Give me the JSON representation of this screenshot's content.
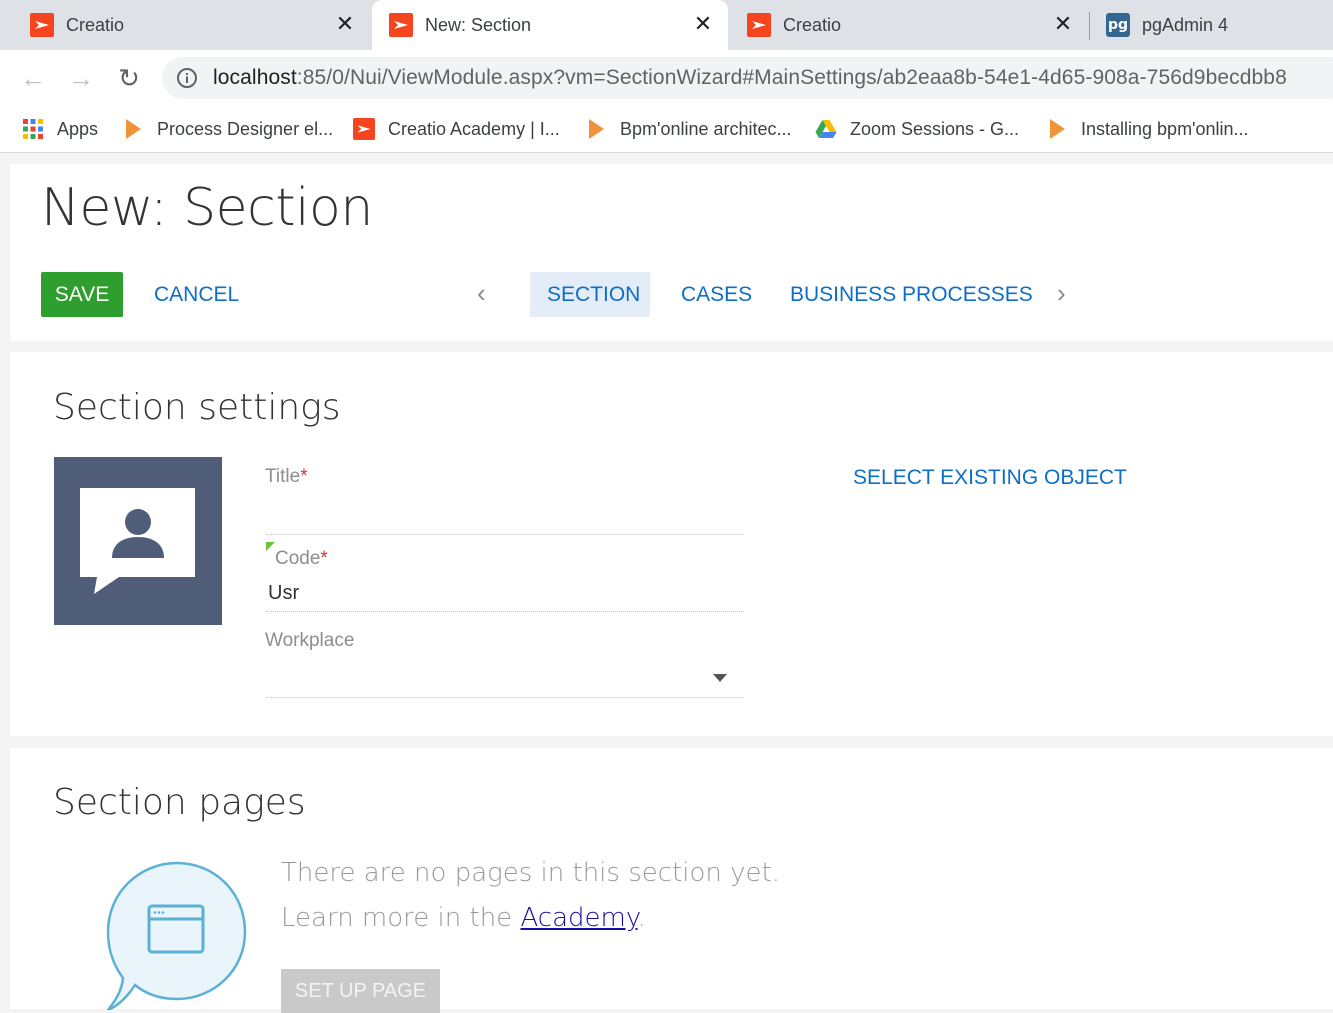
{
  "browser": {
    "tabs": [
      {
        "title": "Creatio",
        "active": false,
        "icon": "creatio-icon"
      },
      {
        "title": "New: Section",
        "active": true,
        "icon": "creatio-icon"
      },
      {
        "title": "Creatio",
        "active": false,
        "icon": "creatio-icon"
      },
      {
        "title": "pgAdmin 4",
        "active": false,
        "icon": "pgadmin-icon"
      }
    ],
    "close_glyph": "✕",
    "pg_icon_text": "pg",
    "url_host": "localhost",
    "url_rest": ":85/0/Nui/ViewModule.aspx?vm=SectionWizard#MainSettings/ab2eaa8b-54e1-4d65-908a-756d9becdbb8",
    "nav": {
      "back": "←",
      "forward": "→",
      "reload": "↻"
    },
    "bookmarks": [
      {
        "label": "Apps",
        "icon": "apps-grid-icon"
      },
      {
        "label": "Process Designer el...",
        "icon": "play-icon"
      },
      {
        "label": "Creatio Academy | I...",
        "icon": "creatio-icon"
      },
      {
        "label": "Bpm'online architec...",
        "icon": "play-icon"
      },
      {
        "label": "Zoom Sessions - G...",
        "icon": "google-drive-icon"
      },
      {
        "label": "Installing bpm'onlin...",
        "icon": "play-icon"
      }
    ]
  },
  "header": {
    "title": "New: Section",
    "save_label": "SAVE",
    "cancel_label": "CANCEL",
    "prev_arrow": "‹",
    "next_arrow": "›",
    "tabs": [
      {
        "label": "SECTION",
        "active": true
      },
      {
        "label": "CASES",
        "active": false
      },
      {
        "label": "BUSINESS PROCESSES",
        "active": false
      }
    ]
  },
  "settings": {
    "title": "Section settings",
    "title_label": "Title",
    "title_value": "",
    "code_label": "Code",
    "code_value": "Usr",
    "workplace_label": "Workplace",
    "workplace_value": "",
    "required_mark": "*",
    "select_existing_label": "SELECT EXISTING OBJECT"
  },
  "pages": {
    "title": "Section pages",
    "empty_line1": "There are no pages in this section yet.",
    "empty_line2_prefix": "Learn more in the ",
    "academy_link": "Academy",
    "empty_line2_suffix": ".",
    "setup_button": "SET UP PAGE"
  },
  "colors": {
    "accent_blue": "#0e6ec7",
    "save_green": "#2e9e2e",
    "creatio_red": "#f5451f",
    "avatar_bg": "#4f5d78"
  }
}
